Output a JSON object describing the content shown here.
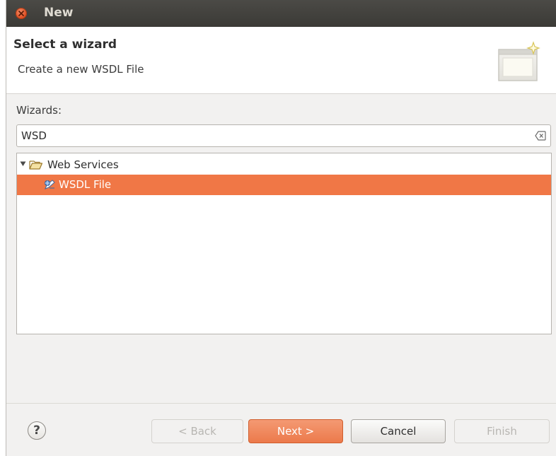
{
  "window": {
    "title": "New"
  },
  "header": {
    "title": "Select a wizard",
    "subtitle": "Create a new WSDL File",
    "icon": "new-wizard-banner-icon"
  },
  "wizards": {
    "label": "Wizards:",
    "filter_value": "WSD",
    "clear_icon": "clear-text-icon"
  },
  "tree": {
    "items": [
      {
        "label": "Web Services",
        "icon": "folder-open-icon",
        "expanded": true,
        "depth": 0
      },
      {
        "label": "WSDL File",
        "icon": "wsdl-file-icon",
        "selected": true,
        "depth": 1
      }
    ]
  },
  "footer": {
    "help_label": "?",
    "back_label": "< Back",
    "next_label": "Next >",
    "cancel_label": "Cancel",
    "finish_label": "Finish"
  },
  "colors": {
    "selection": "#f07746",
    "titlebar": "#3f3e3a",
    "close_button": "#df4b1f"
  }
}
